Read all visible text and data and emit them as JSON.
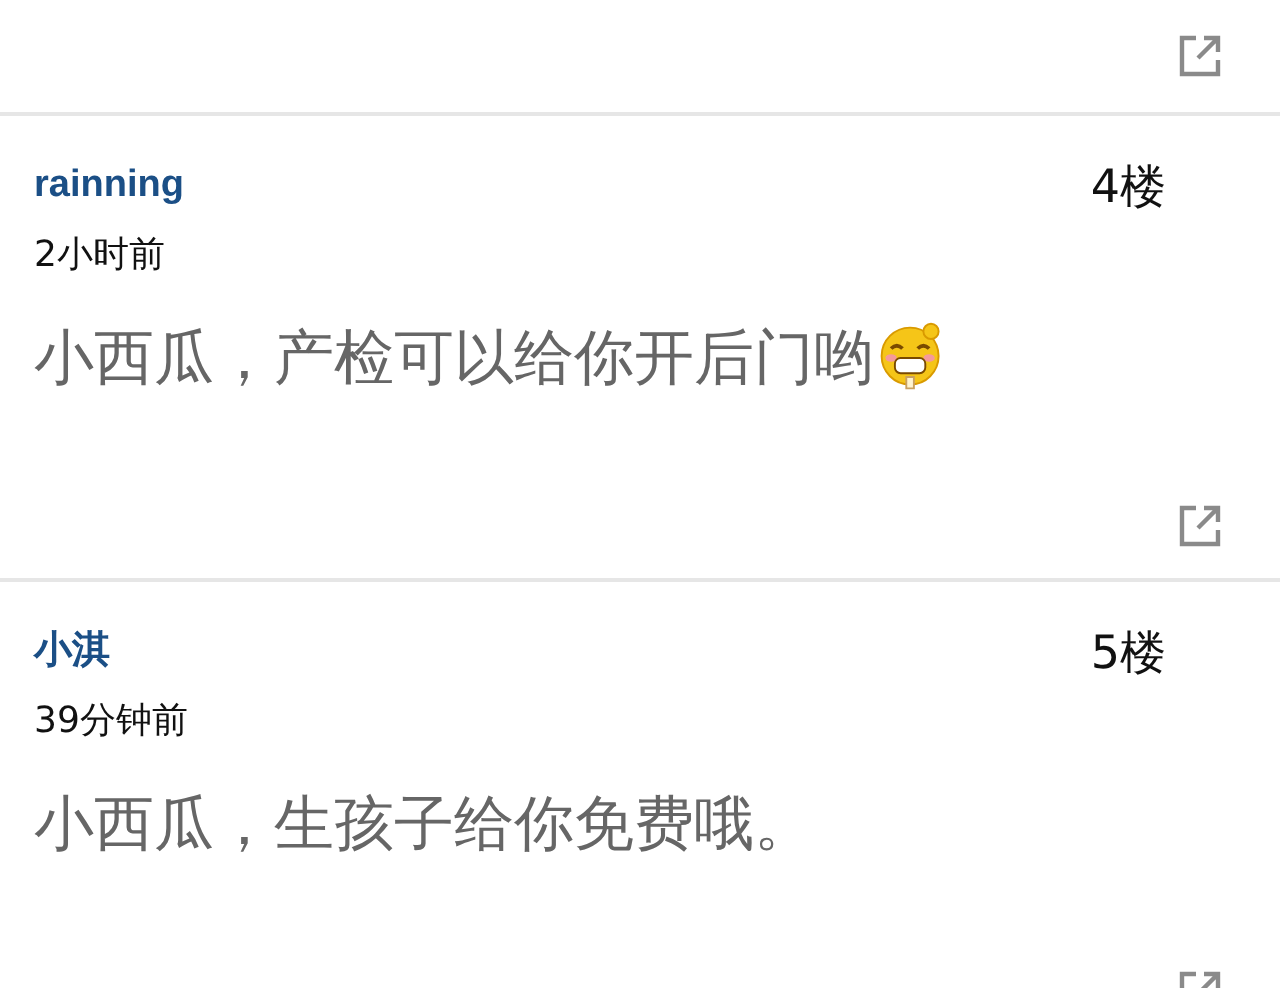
{
  "posts": [
    {
      "username": "rainning",
      "time": "2小时前",
      "floor": "4楼",
      "content": "小西瓜，产检可以给你开后门哟",
      "has_emoji": true
    },
    {
      "username": "小淇",
      "time": "39分钟前",
      "floor": "5楼",
      "content": "小西瓜，生孩子给你免费哦。",
      "has_emoji": false
    }
  ]
}
